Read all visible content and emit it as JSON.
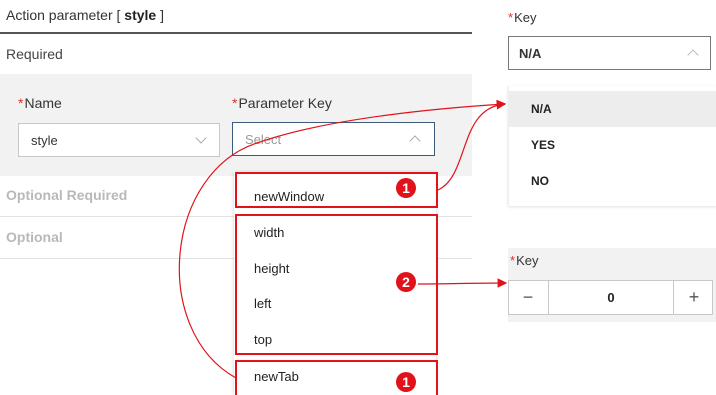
{
  "section": {
    "title_prefix": "Action parameter [ ",
    "title_param": "style",
    "title_suffix": " ]"
  },
  "required": {
    "heading": "Required",
    "name_label": "Name",
    "name_value": "style",
    "param_key_label": "Parameter Key",
    "param_key_placeholder": "Select"
  },
  "optional_required": {
    "heading": "Optional Required"
  },
  "optional": {
    "heading": "Optional"
  },
  "param_key_options": [
    "newWindow",
    "width",
    "height",
    "left",
    "top",
    "newTab"
  ],
  "callouts": [
    "1",
    "2",
    "1"
  ],
  "key_select": {
    "label": "Key",
    "value": "N/A",
    "options": [
      "N/A",
      "YES",
      "NO"
    ],
    "selected_index": 0
  },
  "key_stepper": {
    "label": "Key",
    "minus": "−",
    "value": "0",
    "plus": "+"
  },
  "colors": {
    "highlight": "#e0131b",
    "required_asterisk": "#e0312a",
    "panel_bg": "#f2f2f2"
  }
}
